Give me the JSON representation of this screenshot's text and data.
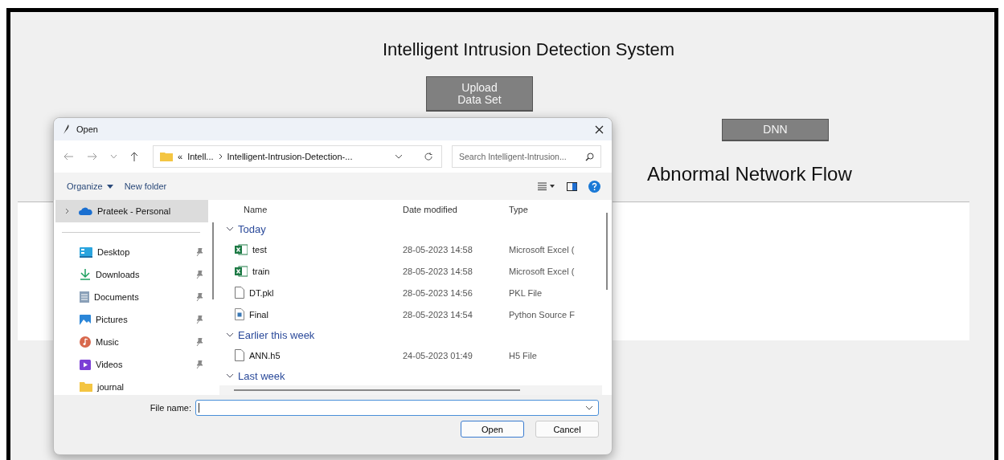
{
  "app": {
    "title": "Intelligent Intrusion Detection System",
    "upload_button": "Upload\nData Set",
    "dnn_button": "DNN",
    "section_title": "Abnormal Network Flow"
  },
  "dialog": {
    "title": "Open",
    "path": [
      "«",
      "Intell...",
      "Intelligent-Intrusion-Detection-..."
    ],
    "search": {
      "placeholder": "Search Intelligent-Intrusion..."
    },
    "toolbar": [
      "Organize",
      "New folder"
    ],
    "sidebar": [
      {
        "label": "Prateek - Personal",
        "kind": "cloud",
        "selected": true,
        "pinned": false
      },
      {
        "label": "Desktop",
        "kind": "desktop",
        "selected": false,
        "pinned": true
      },
      {
        "label": "Downloads",
        "kind": "downloads",
        "selected": false,
        "pinned": true
      },
      {
        "label": "Documents",
        "kind": "documents",
        "selected": false,
        "pinned": true
      },
      {
        "label": "Pictures",
        "kind": "pictures",
        "selected": false,
        "pinned": true
      },
      {
        "label": "Music",
        "kind": "music",
        "selected": false,
        "pinned": true
      },
      {
        "label": "Videos",
        "kind": "videos",
        "selected": false,
        "pinned": true
      },
      {
        "label": "journal",
        "kind": "folder",
        "selected": false,
        "pinned": false
      }
    ],
    "columns": [
      "Name",
      "Date modified",
      "Type"
    ],
    "groups": [
      {
        "label": "Today",
        "expanded": true,
        "files": [
          {
            "name": "test",
            "date": "28-05-2023 14:58",
            "type": "Microsoft Excel (",
            "kind": "excel"
          },
          {
            "name": "train",
            "date": "28-05-2023 14:58",
            "type": "Microsoft Excel (",
            "kind": "excel"
          },
          {
            "name": "DT.pkl",
            "date": "28-05-2023 14:56",
            "type": "PKL File",
            "kind": "file"
          },
          {
            "name": "Final",
            "date": "28-05-2023 14:54",
            "type": "Python Source F",
            "kind": "python"
          }
        ]
      },
      {
        "label": "Earlier this week",
        "expanded": true,
        "files": [
          {
            "name": "ANN.h5",
            "date": "24-05-2023 01:49",
            "type": "H5 File",
            "kind": "file"
          }
        ]
      },
      {
        "label": "Last week",
        "expanded": true
      }
    ],
    "file_name_label": "File name:",
    "buttons": [
      "Open",
      "Cancel"
    ]
  }
}
